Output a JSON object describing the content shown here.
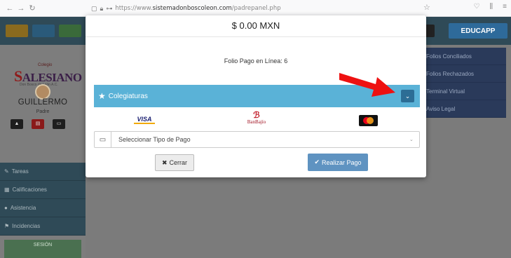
{
  "browser": {
    "url_prefix": "https://www.",
    "url_host": "sistemadonboscoleon.com",
    "url_path": "/padrepanel.php"
  },
  "sidebar": {
    "logo_small": "Colegio",
    "logo_main": "ALESIANO",
    "logo_initial": "S",
    "logo_sub": "Don Bosco de León A.C.",
    "user_name": "GUILLERMO",
    "user_role": "Padre",
    "menu": [
      {
        "label": "Tareas"
      },
      {
        "label": "Calificaciones"
      },
      {
        "label": "Asistencia"
      },
      {
        "label": "Incidencias"
      }
    ],
    "sesion": "SESIÓN"
  },
  "right_menu": {
    "brand": "EDUCAPP",
    "items": [
      "Folios Conciliados",
      "Folios Rechazados",
      "Terminal Virtual",
      "Aviso Legal"
    ]
  },
  "modal": {
    "amount": "$ 0.00 MXN",
    "folio": "Folio Pago en Línea: 6",
    "accordion_title": "Colegiaturas",
    "logo_visa": "VISA",
    "logo_banbajio": "BanBajío",
    "payment_placeholder": "Seleccionar Tipo de Pago",
    "close_label": "Cerrar",
    "pay_label": "Realizar Pago"
  }
}
